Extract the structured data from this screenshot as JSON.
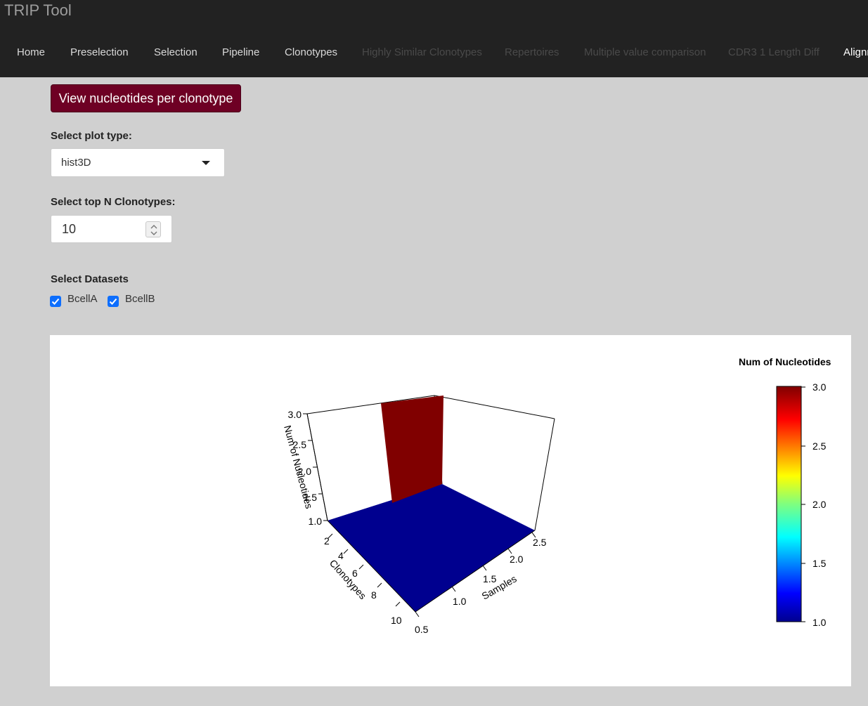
{
  "app": {
    "title": "TRIP Tool"
  },
  "nav": {
    "items": [
      {
        "label": "Home",
        "state": "normal"
      },
      {
        "label": "Preselection",
        "state": "normal"
      },
      {
        "label": "Selection",
        "state": "normal"
      },
      {
        "label": "Pipeline",
        "state": "normal"
      },
      {
        "label": "Clonotypes",
        "state": "normal"
      },
      {
        "label": "Highly Similar Clonotypes",
        "state": "disabled"
      },
      {
        "label": "Repertoires",
        "state": "disabled"
      },
      {
        "label": "Multiple value comparison",
        "state": "disabled"
      },
      {
        "label": "CDR3 1 Length Diff",
        "state": "disabled"
      },
      {
        "label": "Alignm",
        "state": "active"
      }
    ]
  },
  "main": {
    "view_button_label": "View nucleotides per clonotype",
    "plot_type": {
      "label": "Select plot type:",
      "selected": "hist3D"
    },
    "top_n": {
      "label": "Select top N Clonotypes:",
      "value": "10"
    },
    "datasets": {
      "label": "Select Datasets",
      "items": [
        {
          "label": "BcellA",
          "checked": true
        },
        {
          "label": "BcellB",
          "checked": true
        }
      ]
    }
  },
  "colors": {
    "accent_button": "#6e0024",
    "nav_background": "#222222",
    "checkbox": "#0d6efd",
    "surface_blue": "#00008f",
    "bar_red": "#800000"
  },
  "chart_data": {
    "type": "hist3D",
    "z_axis": {
      "label": "Num of Nucleotides",
      "ticks": [
        "3.0",
        "2.5",
        "2.0",
        "1.5",
        "1.0"
      ],
      "range": [
        1.0,
        3.0
      ]
    },
    "clonotype_axis": {
      "label": "Clonotypes",
      "ticks": [
        "2",
        "4",
        "6",
        "8",
        "10"
      ],
      "range": [
        1,
        10
      ]
    },
    "sample_axis": {
      "label": "Samples",
      "ticks": [
        "0.5",
        "1.0",
        "1.5",
        "2.0",
        "2.5"
      ],
      "range": [
        0.5,
        2.5
      ]
    },
    "surface_value": 1.0,
    "bar": {
      "clonotype": 1,
      "value": 3.0
    },
    "colorbar": {
      "title": "Num of Nucleotides",
      "ticks": [
        "3.0",
        "2.5",
        "2.0",
        "1.5",
        "1.0"
      ],
      "range": [
        1.0,
        3.0
      ]
    },
    "grid": false
  }
}
